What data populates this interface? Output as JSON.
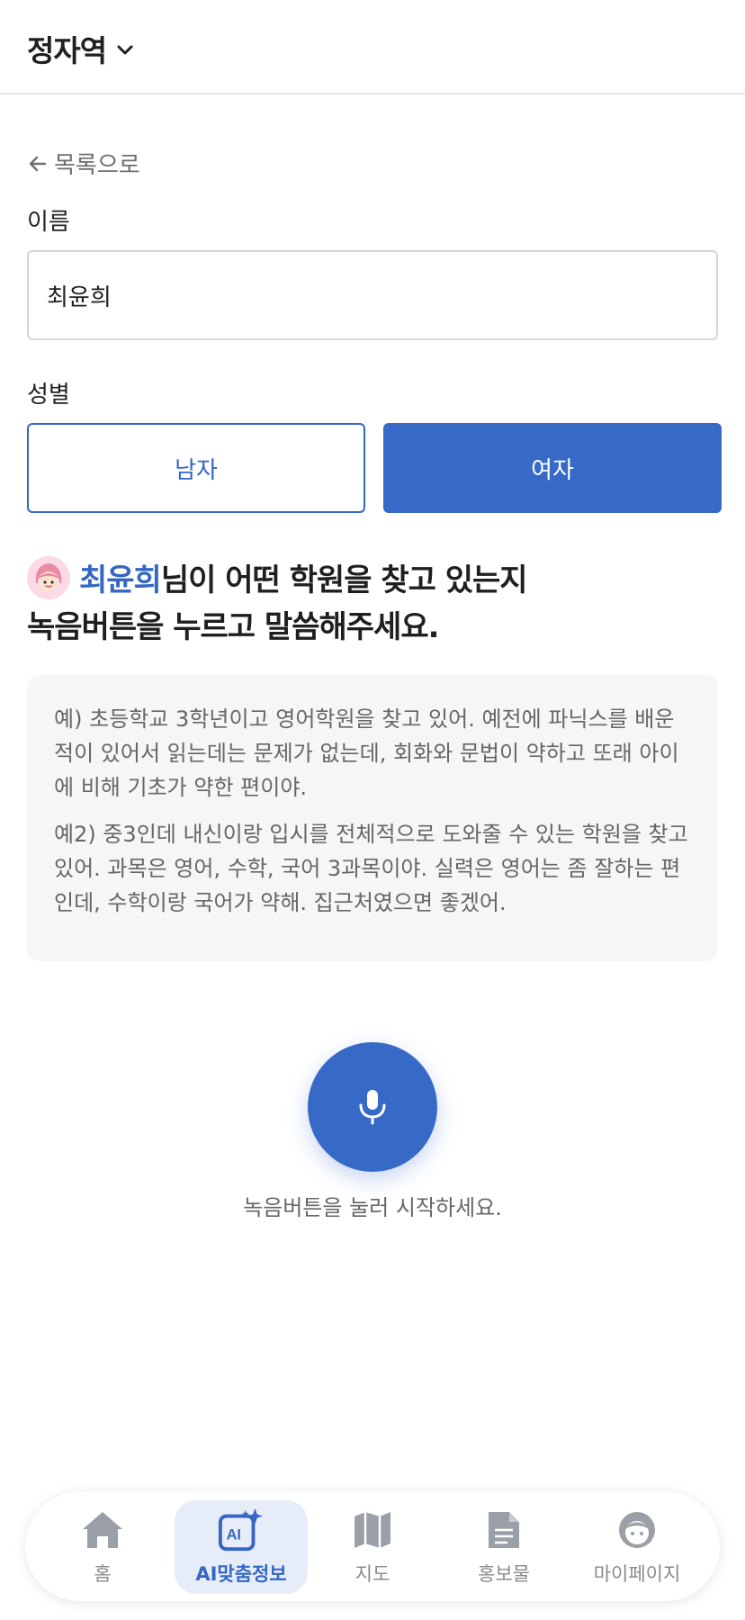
{
  "header": {
    "station": "정자역",
    "chevron_icon": "chevron-down-icon"
  },
  "back": {
    "label": "목록으로",
    "icon": "arrow-left-icon"
  },
  "form": {
    "name_label": "이름",
    "name_value": "최윤희",
    "gender_label": "성별",
    "gender_options": [
      "남자",
      "여자"
    ],
    "gender_selected": "여자"
  },
  "prompt": {
    "name": "최윤희",
    "line1_rest": "님이 어떤 학원을 찾고 있는지",
    "line2": "녹음버튼을 누르고 말씀해주세요.",
    "avatar_icon": "girl-avatar-icon"
  },
  "examples": {
    "ex1": "예) 초등학교 3학년이고 영어학원을 찾고 있어. 예전에 파닉스를 배운적이 있어서 읽는데는 문제가 없는데, 회화와 문법이 약하고 또래 아이에 비해 기초가 약한 편이야.",
    "ex2": "예2) 중3인데 내신이랑 입시를 전체적으로 도와줄 수 있는 학원을 찾고 있어. 과목은 영어, 수학, 국어 3과목이야. 실력은 영어는 좀 잘하는 편인데, 수학이랑 국어가 약해. 집근처였으면 좋겠어."
  },
  "mic": {
    "icon": "microphone-icon",
    "hint": "녹음버튼을 눌러 시작하세요."
  },
  "nav": {
    "items": [
      {
        "label": "홈",
        "icon": "home-icon"
      },
      {
        "label": "AI맞춤정보",
        "icon": "ai-sparkle-icon"
      },
      {
        "label": "지도",
        "icon": "map-icon"
      },
      {
        "label": "홍보물",
        "icon": "document-icon"
      },
      {
        "label": "마이페이지",
        "icon": "face-icon"
      }
    ],
    "active": "AI맞춤정보"
  },
  "colors": {
    "accent": "#3769c6",
    "active_nav_bg": "#e6edf9",
    "example_bg": "#f6f6f6"
  }
}
